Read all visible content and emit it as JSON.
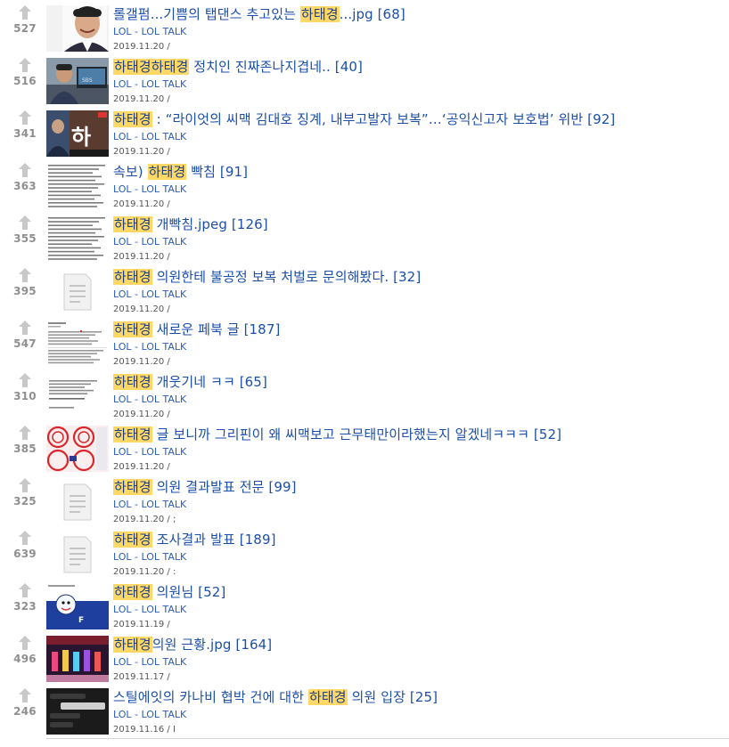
{
  "category": "LOL - LOL TALK",
  "colors": {
    "title_link": "#1c4fa8",
    "highlight_bg": "#ffd866",
    "vote_count": "#8f8f8f",
    "arrow": "#c8c8c8"
  },
  "posts": [
    {
      "votes": "527",
      "pre": "롤갤펌...기쁨의 탭댄스 추고있는 ",
      "hl": "하태경",
      "post": "...jpg [68]",
      "cat": "LOL - LOL TALK",
      "date": "2019.11.20 /",
      "thumb": "photo-man-smiling"
    },
    {
      "votes": "516",
      "pre": "",
      "hl": "하태경하태경",
      "post": " 정치인 진짜존나지겹네.. [40]",
      "cat": "LOL - LOL TALK",
      "date": "2019.11.20 /",
      "thumb": "photo-man-at-computer"
    },
    {
      "votes": "341",
      "pre": "",
      "hl": "하태경",
      "post": " : “라이엇의 씨맥 김대호 징계, 내부고발자 보복”…‘공익신고자 보호법’ 위반 [92]",
      "cat": "LOL - LOL TALK",
      "date": "2019.11.20 /",
      "thumb": "news-capture"
    },
    {
      "votes": "363",
      "pre": "속보) ",
      "hl": "하태경",
      "post": " 빡침 [91]",
      "cat": "LOL - LOL TALK",
      "date": "2019.11.20 /",
      "thumb": "text-document"
    },
    {
      "votes": "355",
      "pre": "",
      "hl": "하태경",
      "post": " 개빡침.jpeg [126]",
      "cat": "LOL - LOL TALK",
      "date": "2019.11.20 /",
      "thumb": "text-document"
    },
    {
      "votes": "395",
      "pre": "",
      "hl": "하태경",
      "post": " 의원한테 불공정 보복 처벌로 문의해봤다. [32]",
      "cat": "LOL - LOL TALK",
      "date": "2019.11.20 /",
      "thumb": "document-placeholder-icon"
    },
    {
      "votes": "547",
      "pre": "",
      "hl": "하태경",
      "post": " 새로운 페북 글 [187]",
      "cat": "LOL - LOL TALK",
      "date": "2019.11.20 /",
      "thumb": "facebook-post"
    },
    {
      "votes": "310",
      "pre": "",
      "hl": "하태경",
      "post": " 개웃기네 ㅋㅋ [65]",
      "cat": "LOL - LOL TALK",
      "date": "2019.11.20 /",
      "thumb": "text-screenshot"
    },
    {
      "votes": "385",
      "pre": "",
      "hl": "하태경",
      "post": " 글 보니까 그리핀이 왜 씨맥보고 근무태만이라했는지 알겠네ㅋㅋㅋ [52]",
      "cat": "LOL - LOL TALK",
      "date": "2019.11.20 /",
      "thumb": "red-stamps"
    },
    {
      "votes": "325",
      "pre": "",
      "hl": "하태경",
      "post": " 의원 결과발표 전문 [99]",
      "cat": "LOL - LOL TALK",
      "date": "2019.11.20 / ;",
      "thumb": "document-placeholder-icon"
    },
    {
      "votes": "639",
      "pre": "",
      "hl": "하태경",
      "post": " 조사결과 발표 [189]",
      "cat": "LOL - LOL TALK",
      "date": "2019.11.20 / :",
      "thumb": "document-placeholder-icon"
    },
    {
      "votes": "323",
      "pre": "",
      "hl": "하태경",
      "post": " 의원님 [52]",
      "cat": "LOL - LOL TALK",
      "date": "2019.11.19 /",
      "thumb": "blue-mascot"
    },
    {
      "votes": "496",
      "pre": "",
      "hl": "하태경",
      "post": "의원 근황.jpg [164]",
      "cat": "LOL - LOL TALK",
      "date": "2019.11.17 /",
      "thumb": "stage-group-photo"
    },
    {
      "votes": "246",
      "pre": "스틸에잇의 카나비 협박 건에 대한 ",
      "hl": "하태경",
      "post": " 의원 입장 [25]",
      "cat": "LOL - LOL TALK",
      "date": "2019.11.16 / I",
      "thumb": "dark-chat-screenshot"
    }
  ]
}
